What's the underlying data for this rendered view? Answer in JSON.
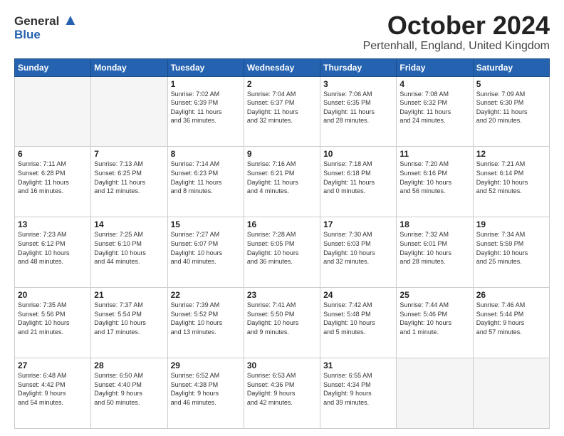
{
  "logo": {
    "line1": "General",
    "line2": "Blue"
  },
  "title": "October 2024",
  "subtitle": "Pertenhall, England, United Kingdom",
  "headers": [
    "Sunday",
    "Monday",
    "Tuesday",
    "Wednesday",
    "Thursday",
    "Friday",
    "Saturday"
  ],
  "weeks": [
    [
      {
        "day": "",
        "empty": true
      },
      {
        "day": "",
        "empty": true
      },
      {
        "day": "1",
        "info": "Sunrise: 7:02 AM\nSunset: 6:39 PM\nDaylight: 11 hours\nand 36 minutes."
      },
      {
        "day": "2",
        "info": "Sunrise: 7:04 AM\nSunset: 6:37 PM\nDaylight: 11 hours\nand 32 minutes."
      },
      {
        "day": "3",
        "info": "Sunrise: 7:06 AM\nSunset: 6:35 PM\nDaylight: 11 hours\nand 28 minutes."
      },
      {
        "day": "4",
        "info": "Sunrise: 7:08 AM\nSunset: 6:32 PM\nDaylight: 11 hours\nand 24 minutes."
      },
      {
        "day": "5",
        "info": "Sunrise: 7:09 AM\nSunset: 6:30 PM\nDaylight: 11 hours\nand 20 minutes."
      }
    ],
    [
      {
        "day": "6",
        "info": "Sunrise: 7:11 AM\nSunset: 6:28 PM\nDaylight: 11 hours\nand 16 minutes."
      },
      {
        "day": "7",
        "info": "Sunrise: 7:13 AM\nSunset: 6:25 PM\nDaylight: 11 hours\nand 12 minutes."
      },
      {
        "day": "8",
        "info": "Sunrise: 7:14 AM\nSunset: 6:23 PM\nDaylight: 11 hours\nand 8 minutes."
      },
      {
        "day": "9",
        "info": "Sunrise: 7:16 AM\nSunset: 6:21 PM\nDaylight: 11 hours\nand 4 minutes."
      },
      {
        "day": "10",
        "info": "Sunrise: 7:18 AM\nSunset: 6:18 PM\nDaylight: 11 hours\nand 0 minutes."
      },
      {
        "day": "11",
        "info": "Sunrise: 7:20 AM\nSunset: 6:16 PM\nDaylight: 10 hours\nand 56 minutes."
      },
      {
        "day": "12",
        "info": "Sunrise: 7:21 AM\nSunset: 6:14 PM\nDaylight: 10 hours\nand 52 minutes."
      }
    ],
    [
      {
        "day": "13",
        "info": "Sunrise: 7:23 AM\nSunset: 6:12 PM\nDaylight: 10 hours\nand 48 minutes."
      },
      {
        "day": "14",
        "info": "Sunrise: 7:25 AM\nSunset: 6:10 PM\nDaylight: 10 hours\nand 44 minutes."
      },
      {
        "day": "15",
        "info": "Sunrise: 7:27 AM\nSunset: 6:07 PM\nDaylight: 10 hours\nand 40 minutes."
      },
      {
        "day": "16",
        "info": "Sunrise: 7:28 AM\nSunset: 6:05 PM\nDaylight: 10 hours\nand 36 minutes."
      },
      {
        "day": "17",
        "info": "Sunrise: 7:30 AM\nSunset: 6:03 PM\nDaylight: 10 hours\nand 32 minutes."
      },
      {
        "day": "18",
        "info": "Sunrise: 7:32 AM\nSunset: 6:01 PM\nDaylight: 10 hours\nand 28 minutes."
      },
      {
        "day": "19",
        "info": "Sunrise: 7:34 AM\nSunset: 5:59 PM\nDaylight: 10 hours\nand 25 minutes."
      }
    ],
    [
      {
        "day": "20",
        "info": "Sunrise: 7:35 AM\nSunset: 5:56 PM\nDaylight: 10 hours\nand 21 minutes."
      },
      {
        "day": "21",
        "info": "Sunrise: 7:37 AM\nSunset: 5:54 PM\nDaylight: 10 hours\nand 17 minutes."
      },
      {
        "day": "22",
        "info": "Sunrise: 7:39 AM\nSunset: 5:52 PM\nDaylight: 10 hours\nand 13 minutes."
      },
      {
        "day": "23",
        "info": "Sunrise: 7:41 AM\nSunset: 5:50 PM\nDaylight: 10 hours\nand 9 minutes."
      },
      {
        "day": "24",
        "info": "Sunrise: 7:42 AM\nSunset: 5:48 PM\nDaylight: 10 hours\nand 5 minutes."
      },
      {
        "day": "25",
        "info": "Sunrise: 7:44 AM\nSunset: 5:46 PM\nDaylight: 10 hours\nand 1 minute."
      },
      {
        "day": "26",
        "info": "Sunrise: 7:46 AM\nSunset: 5:44 PM\nDaylight: 9 hours\nand 57 minutes."
      }
    ],
    [
      {
        "day": "27",
        "info": "Sunrise: 6:48 AM\nSunset: 4:42 PM\nDaylight: 9 hours\nand 54 minutes."
      },
      {
        "day": "28",
        "info": "Sunrise: 6:50 AM\nSunset: 4:40 PM\nDaylight: 9 hours\nand 50 minutes."
      },
      {
        "day": "29",
        "info": "Sunrise: 6:52 AM\nSunset: 4:38 PM\nDaylight: 9 hours\nand 46 minutes."
      },
      {
        "day": "30",
        "info": "Sunrise: 6:53 AM\nSunset: 4:36 PM\nDaylight: 9 hours\nand 42 minutes."
      },
      {
        "day": "31",
        "info": "Sunrise: 6:55 AM\nSunset: 4:34 PM\nDaylight: 9 hours\nand 39 minutes."
      },
      {
        "day": "",
        "empty": true
      },
      {
        "day": "",
        "empty": true
      }
    ]
  ]
}
